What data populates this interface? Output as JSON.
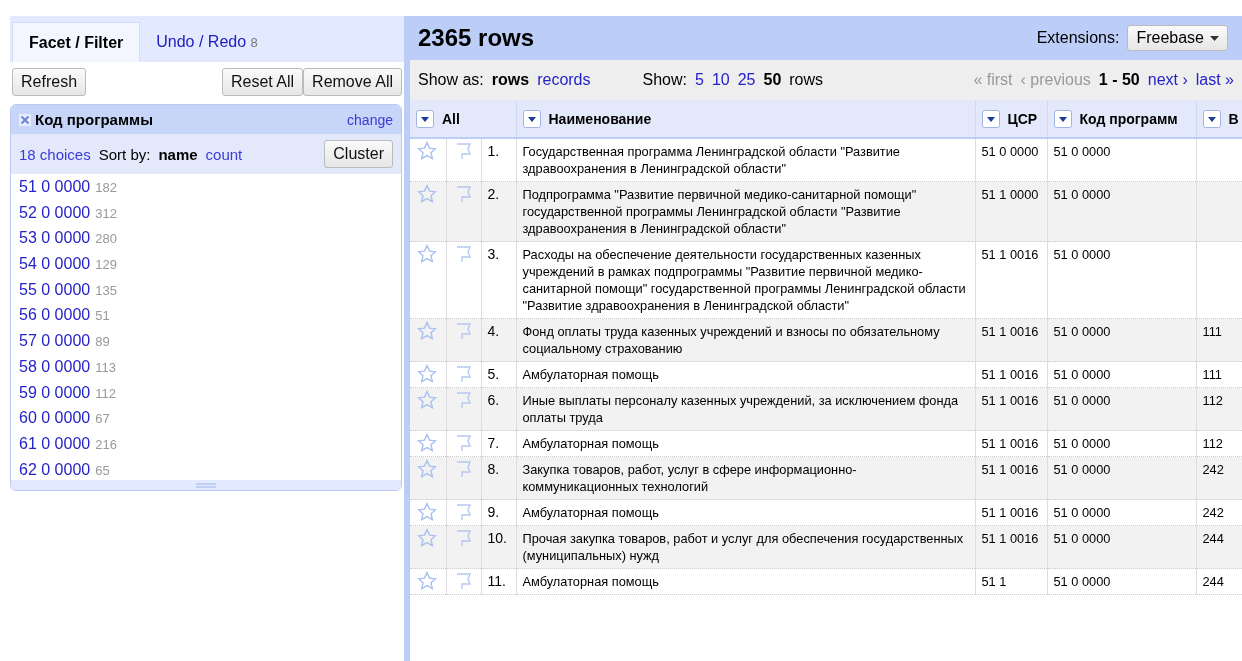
{
  "left_panel": {
    "tabs": [
      {
        "label": "Facet / Filter",
        "selected": true
      },
      {
        "label": "Undo / Redo",
        "count": "8",
        "selected": false
      }
    ],
    "refresh_button": "Refresh",
    "reset_all_button": "Reset All",
    "remove_all_button": "Remove All",
    "facet": {
      "title": "Код программы",
      "change_link": "change",
      "choices": "18 choices",
      "sort_label": "Sort by:",
      "sort_options": [
        {
          "label": "name",
          "selected": true
        },
        {
          "label": "count",
          "selected": false
        }
      ],
      "cluster_button": "Cluster",
      "items": [
        {
          "value": "51 0 0000",
          "count": "182"
        },
        {
          "value": "52 0 0000",
          "count": "312"
        },
        {
          "value": "53 0 0000",
          "count": "280"
        },
        {
          "value": "54 0 0000",
          "count": "129"
        },
        {
          "value": "55 0 0000",
          "count": "135"
        },
        {
          "value": "56 0 0000",
          "count": "51"
        },
        {
          "value": "57 0 0000",
          "count": "89"
        },
        {
          "value": "58 0 0000",
          "count": "113"
        },
        {
          "value": "59 0 0000",
          "count": "112"
        },
        {
          "value": "60 0 0000",
          "count": "67"
        },
        {
          "value": "61 0 0000",
          "count": "216"
        },
        {
          "value": "62 0 0000",
          "count": "65"
        }
      ]
    }
  },
  "data_panel": {
    "title": "2365 rows",
    "extensions_label": "Extensions:",
    "extensions_button": "Freebase",
    "show_as_label": "Show as:",
    "view_modes": [
      {
        "label": "rows",
        "selected": true
      },
      {
        "label": "records",
        "selected": false
      }
    ],
    "show_label": "Show:",
    "page_sizes": [
      {
        "label": "5",
        "selected": false
      },
      {
        "label": "10",
        "selected": false
      },
      {
        "label": "25",
        "selected": false
      },
      {
        "label": "50",
        "selected": true
      }
    ],
    "rows_label": "rows",
    "pager": {
      "first": "« first",
      "previous": "‹ previous",
      "range": "1 - 50",
      "next": "next ›",
      "last": "last »"
    },
    "columns": [
      {
        "label": "All"
      },
      {
        "label": "Наименование"
      },
      {
        "label": "ЦСР"
      },
      {
        "label": "Код программ"
      },
      {
        "label": "В"
      }
    ],
    "rows": [
      {
        "number": "1.",
        "name": "Государственная программа Ленинградской области \"Развитие здравоохранения в Ленинградской области\"",
        "csr": "51 0 0000",
        "program": "51 0 0000",
        "column_5": ""
      },
      {
        "number": "2.",
        "name": "Подпрограмма \"Развитие первичной медико-санитарной помощи\" государственной программы Ленинградской области \"Развитие здравоохранения в Ленинградской области\"",
        "csr": "51 1 0000",
        "program": "51 0 0000",
        "column_5": ""
      },
      {
        "number": "3.",
        "name": "Расходы на обеспечение деятельности государственных казенных учреждений в рамках подпрограммы \"Развитие первичной медико-санитарной помощи\" государственной программы Ленинградской области \"Развитие здравоохранения в Ленинградской области\"",
        "csr": "51 1 0016",
        "program": "51 0 0000",
        "column_5": ""
      },
      {
        "number": "4.",
        "name": "Фонд оплаты труда казенных учреждений и взносы по обязательному социальному страхованию",
        "csr": "51 1 0016",
        "program": "51 0 0000",
        "column_5": "111"
      },
      {
        "number": "5.",
        "name": "Амбулаторная помощь",
        "csr": "51 1 0016",
        "program": "51 0 0000",
        "column_5": "111"
      },
      {
        "number": "6.",
        "name": "Иные выплаты персоналу казенных учреждений, за исключением фонда оплаты труда",
        "csr": "51 1 0016",
        "program": "51 0 0000",
        "column_5": "112"
      },
      {
        "number": "7.",
        "name": "Амбулаторная помощь",
        "csr": "51 1 0016",
        "program": "51 0 0000",
        "column_5": "112"
      },
      {
        "number": "8.",
        "name": "Закупка товаров, работ, услуг в сфере информационно-коммуникационных технологий",
        "csr": "51 1 0016",
        "program": "51 0 0000",
        "column_5": "242"
      },
      {
        "number": "9.",
        "name": "Амбулаторная помощь",
        "csr": "51 1 0016",
        "program": "51 0 0000",
        "column_5": "242"
      },
      {
        "number": "10.",
        "name": "Прочая закупка товаров, работ и услуг для обеспечения государственных (муниципальных) нужд",
        "csr": "51 1 0016",
        "program": "51 0 0000",
        "column_5": "244"
      },
      {
        "number": "11.",
        "name": "Амбулаторная помощь",
        "csr": "51 1",
        "program": "51 0 0000",
        "column_5": "244"
      }
    ]
  }
}
